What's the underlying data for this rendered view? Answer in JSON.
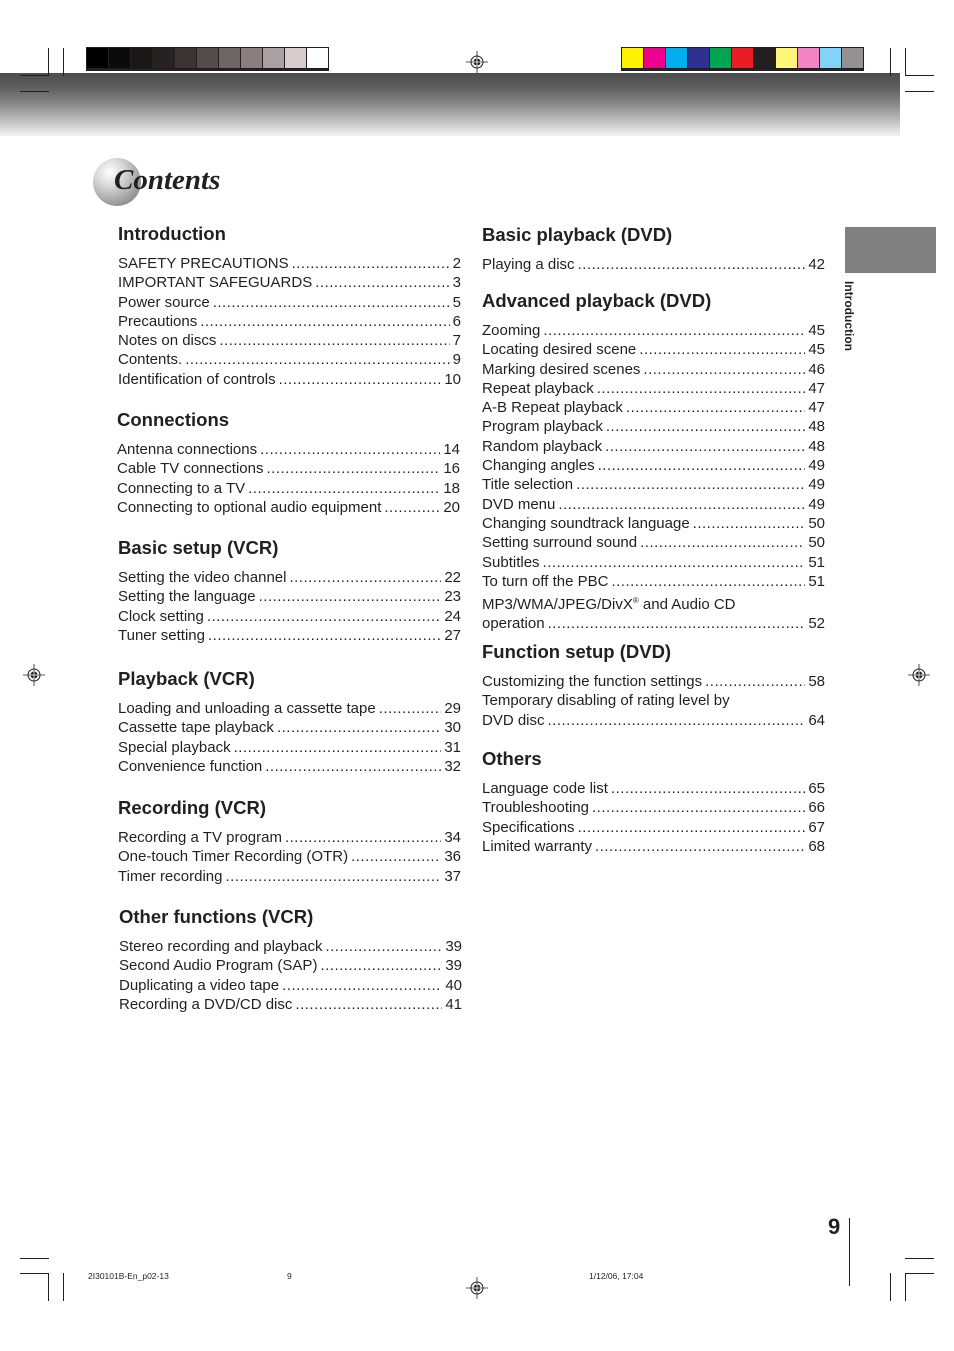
{
  "printer_marks": {
    "gray_swatches": [
      "#000000",
      "#0d0b0a",
      "#1a1716",
      "#272220",
      "#3d3331",
      "#554b48",
      "#6f6563",
      "#8a7f7d",
      "#aaa09f",
      "#d7cccb",
      "#ffffff"
    ],
    "color_swatches": [
      "#fff200",
      "#ec008c",
      "#00aeef",
      "#2e3192",
      "#00a651",
      "#ed1c24",
      "#231f20",
      "#fff67a",
      "#f483c4",
      "#7fd4f7",
      "#939191"
    ]
  },
  "title": "Contents",
  "side_tab": {
    "label": "Introduction",
    "color": "#808080"
  },
  "left_column": [
    {
      "heading": "Introduction",
      "entries": [
        {
          "label": "SAFETY PRECAUTIONS",
          "page": "2"
        },
        {
          "label": "IMPORTANT SAFEGUARDS",
          "page": "3"
        },
        {
          "label": "Power source",
          "page": "5"
        },
        {
          "label": "Precautions",
          "page": "6"
        },
        {
          "label": "Notes on discs",
          "page": "7"
        },
        {
          "label": "Contents.",
          "page": "9"
        },
        {
          "label": "Identification of controls",
          "page": "10"
        }
      ]
    },
    {
      "heading": "Connections",
      "entries": [
        {
          "label": "Antenna connections",
          "page": "14"
        },
        {
          "label": "Cable TV connections",
          "page": "16"
        },
        {
          "label": "Connecting to a TV",
          "page": "18"
        },
        {
          "label": "Connecting to optional audio equipment",
          "page": "20"
        }
      ]
    },
    {
      "heading": "Basic setup (VCR)",
      "entries": [
        {
          "label": "Setting the video channel",
          "page": "22"
        },
        {
          "label": "Setting the language",
          "page": "23"
        },
        {
          "label": "Clock setting",
          "page": "24"
        },
        {
          "label": "Tuner setting",
          "page": "27"
        }
      ]
    },
    {
      "heading": "Playback (VCR)",
      "entries": [
        {
          "label": "Loading and unloading a cassette tape",
          "page": "29"
        },
        {
          "label": "Cassette tape playback",
          "page": "30"
        },
        {
          "label": "Special playback",
          "page": "31"
        },
        {
          "label": "Convenience function",
          "page": "32"
        }
      ]
    },
    {
      "heading": "Recording (VCR)",
      "entries": [
        {
          "label": "Recording a TV program",
          "page": "34"
        },
        {
          "label": "One-touch Timer Recording (OTR)",
          "page": "36"
        },
        {
          "label": "Timer recording",
          "page": "37"
        }
      ]
    },
    {
      "heading": "Other functions (VCR)",
      "entries": [
        {
          "label": "Stereo recording and playback",
          "page": "39"
        },
        {
          "label": "Second Audio Program (SAP)",
          "page": "39"
        },
        {
          "label": "Duplicating a video tape",
          "page": "40"
        },
        {
          "label": "Recording a DVD/CD disc",
          "page": "41"
        }
      ]
    }
  ],
  "right_column": [
    {
      "heading": "Basic playback (DVD)",
      "entries": [
        {
          "label": "Playing a disc",
          "page": "42"
        }
      ]
    },
    {
      "heading": "Advanced playback (DVD)",
      "entries": [
        {
          "label": "Zooming",
          "page": "45"
        },
        {
          "label": "Locating desired scene",
          "page": "45"
        },
        {
          "label": "Marking desired scenes",
          "page": "46"
        },
        {
          "label": "Repeat playback",
          "page": "47"
        },
        {
          "label": "A-B Repeat playback",
          "page": "47"
        },
        {
          "label": "Program playback",
          "page": "48"
        },
        {
          "label": "Random playback",
          "page": "48"
        },
        {
          "label": "Changing angles",
          "page": "49"
        },
        {
          "label": "Title selection",
          "page": "49"
        },
        {
          "label": "DVD menu",
          "page": "49"
        },
        {
          "label": "Changing soundtrack language",
          "page": "50"
        },
        {
          "label": "Setting surround sound",
          "page": "50"
        },
        {
          "label": "Subtitles",
          "page": "51"
        },
        {
          "label": "To turn off the PBC",
          "page": "51"
        },
        {
          "label_line1": "MP3/WMA/JPEG/DivX",
          "label_sup": "®",
          "label_line1_rest": " and Audio CD",
          "label": "operation",
          "page": "52"
        }
      ]
    },
    {
      "heading": "Function setup (DVD)",
      "entries": [
        {
          "label": "Customizing the function settings",
          "page": "58"
        },
        {
          "label_line1": "Temporary disabling of rating level by",
          "label": "DVD disc",
          "page": "64"
        }
      ]
    },
    {
      "heading": "Others",
      "entries": [
        {
          "label": "Language code list",
          "page": "65"
        },
        {
          "label": "Troubleshooting",
          "page": "66"
        },
        {
          "label": "Specifications",
          "page": "67"
        },
        {
          "label": "Limited warranty",
          "page": "68"
        }
      ]
    }
  ],
  "page_number": "9",
  "footer": {
    "file": "2I30101B-En_p02-13",
    "page": "9",
    "timestamp": "1/12/06, 17:04"
  }
}
